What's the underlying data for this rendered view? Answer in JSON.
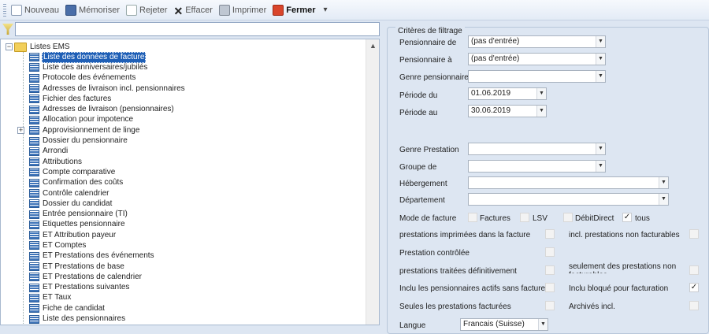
{
  "toolbar": {
    "new": "Nouveau",
    "save": "Mémoriser",
    "reject": "Rejeter",
    "clear": "Effacer",
    "print": "Imprimer",
    "close": "Fermer"
  },
  "tree": {
    "root": "Listes EMS",
    "items": [
      "Liste des données de facture",
      "Liste des anniversaires/jubilés",
      "Protocole des événements",
      "Adresses de livraison incl. pensionnaires",
      "Fichier des factures",
      "Adresses de livraison (pensionnaires)",
      "Allocation pour impotence",
      "Approvisionnement de linge",
      "Dossier du pensionnaire",
      "Arrondi",
      "Attributions",
      "Compte comparative",
      "Confirmation des coûts",
      "Contrôle calendrier",
      "Dossier du candidat",
      "Entrée pensionnaire (TI)",
      "Etiquettes pensionnaire",
      "ET Attribution payeur",
      "ET Comptes",
      "ET Prestations des événements",
      "ET Prestations de base",
      "ET Prestations de calendrier",
      "ET Prestations suivantes",
      "ET Taux",
      "Fiche de candidat",
      "Liste des pensionnaires"
    ]
  },
  "filters": {
    "title": "Critères de filtrage",
    "pens_from_label": "Pensionnaire de",
    "pens_from_value": "(pas d'entrée)",
    "pens_to_label": "Pensionnaire à",
    "pens_to_value": "(pas d'entrée)",
    "genre_pens_label": "Genre pensionnaire",
    "period_from_label": "Période du",
    "period_from_value": "01.06.2019",
    "period_to_label": "Période au",
    "period_to_value": "30.06.2019",
    "genre_prest_label": "Genre Prestation",
    "groupe_label": "Groupe de",
    "hebergement_label": "Hébergement",
    "departement_label": "Département",
    "mode_label": "Mode de facture",
    "mode_factures": "Factures",
    "mode_lsv": "LSV",
    "mode_debit": "DébitDirect",
    "mode_tous": "tous",
    "opt_imprimees": "prestations imprimées dans la facture",
    "opt_non_facturables": "incl. prestations non facturables",
    "opt_controlee": "Prestation contrôlée",
    "opt_traitees": "prestations traitées définitivement",
    "opt_seulement": "seulement des prestations non facturables",
    "opt_inclu_actifs": "Inclu les pensionnaires actifs sans facture",
    "opt_inclu_bloque": "Inclu bloqué pour facturation",
    "opt_seules": "Seules les prestations facturées",
    "opt_archives": "Archivés incl.",
    "langue_label": "Langue",
    "langue_value": "Francais (Suisse)"
  }
}
